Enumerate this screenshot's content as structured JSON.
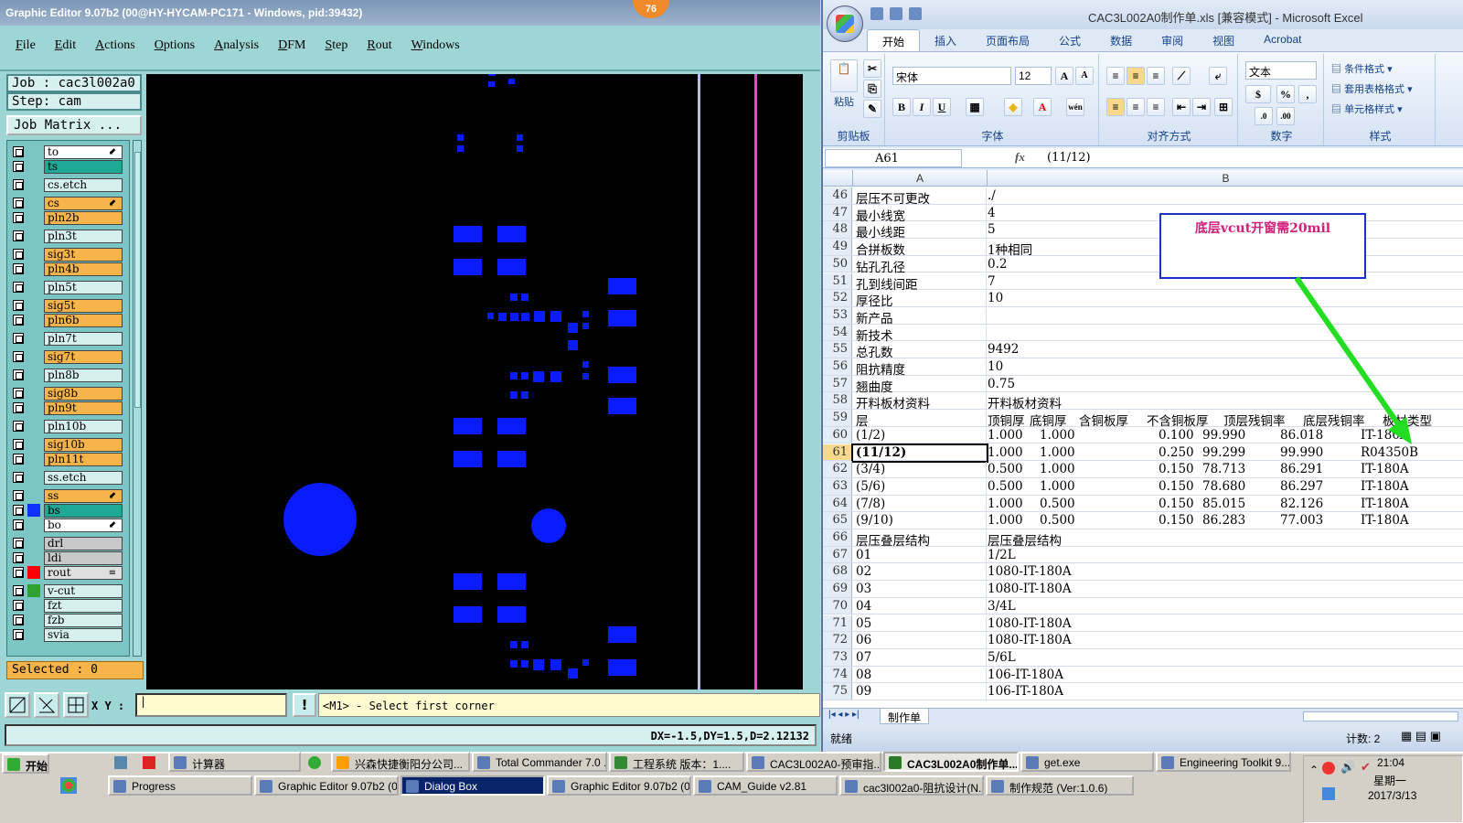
{
  "ge": {
    "title": "Graphic Editor 9.07b2 (00@HY-HYCAM-PC171 - Windows, pid:39432)",
    "badge": "76",
    "menu": [
      "File",
      "Edit",
      "Actions",
      "Options",
      "Analysis",
      "DFM",
      "Step",
      "Rout",
      "Windows"
    ],
    "job": "Job : cac3l002a0",
    "step": "Step: cam",
    "job_matrix": "Job Matrix ...",
    "layers": [
      {
        "name": "to",
        "color": "#ffffff",
        "mark": "⬋",
        "gap": false
      },
      {
        "name": "ts",
        "color": "#1ea896",
        "mark": "",
        "gap": false
      },
      {
        "name": "cs.etch",
        "color": "#d6f0f0",
        "mark": "",
        "gap": true
      },
      {
        "name": "cs",
        "color": "#f6b44a",
        "mark": "⬋",
        "gap": true
      },
      {
        "name": "pln2b",
        "color": "#f6b44a",
        "mark": "",
        "gap": false
      },
      {
        "name": "pln3t",
        "color": "#d6f0f0",
        "mark": "",
        "gap": true
      },
      {
        "name": "sig3t",
        "color": "#f6b44a",
        "mark": "",
        "gap": true
      },
      {
        "name": "pln4b",
        "color": "#f6b44a",
        "mark": "",
        "gap": false
      },
      {
        "name": "pln5t",
        "color": "#d6f0f0",
        "mark": "",
        "gap": true
      },
      {
        "name": "sig5t",
        "color": "#f6b44a",
        "mark": "",
        "gap": true
      },
      {
        "name": "pln6b",
        "color": "#f6b44a",
        "mark": "",
        "gap": false
      },
      {
        "name": "pln7t",
        "color": "#d6f0f0",
        "mark": "",
        "gap": true
      },
      {
        "name": "sig7t",
        "color": "#f6b44a",
        "mark": "",
        "gap": true
      },
      {
        "name": "pln8b",
        "color": "#d6f0f0",
        "mark": "",
        "gap": true
      },
      {
        "name": "sig8b",
        "color": "#f6b44a",
        "mark": "",
        "gap": true
      },
      {
        "name": "pln9t",
        "color": "#f6b44a",
        "mark": "",
        "gap": false
      },
      {
        "name": "pln10b",
        "color": "#d6f0f0",
        "mark": "",
        "gap": true
      },
      {
        "name": "sig10b",
        "color": "#f6b44a",
        "mark": "",
        "gap": true
      },
      {
        "name": "pln11t",
        "color": "#f6b44a",
        "mark": "",
        "gap": false
      },
      {
        "name": "ss.etch",
        "color": "#d6f0f0",
        "mark": "",
        "gap": true
      },
      {
        "name": "ss",
        "color": "#f6b44a",
        "mark": "⬋",
        "gap": true
      },
      {
        "name": "bs",
        "color": "#1ea896",
        "mark": "",
        "gap": false,
        "swatch": "#1030ff"
      },
      {
        "name": "bo",
        "color": "#ffffff",
        "mark": "⬋",
        "gap": false
      },
      {
        "name": "drl",
        "color": "#c8c8c8",
        "mark": "",
        "gap": true
      },
      {
        "name": "ldi",
        "color": "#c8c8c8",
        "mark": "",
        "gap": false
      },
      {
        "name": "rout",
        "color": "#e0e0e0",
        "mark": "≡",
        "gap": false,
        "swatch": "#ff0000"
      },
      {
        "name": "v-cut",
        "color": "#d6f0f0",
        "mark": "",
        "gap": true,
        "swatch": "#30a030"
      },
      {
        "name": "fzt",
        "color": "#d6f0f0",
        "mark": "",
        "gap": false
      },
      {
        "name": "fzb",
        "color": "#d6f0f0",
        "mark": "",
        "gap": false
      },
      {
        "name": "svia",
        "color": "#d6f0f0",
        "mark": "",
        "gap": false
      }
    ],
    "selected": "Selected : 0",
    "xy_label": "X Y :",
    "prompt": "<M1> - Select first corner",
    "status": "DX=-1.5,DY=1.5,D=2.12132",
    "colors": {
      "feature": "#0a1cff",
      "line1": "#b8b8ff",
      "line2": "#ff40c0"
    }
  },
  "xl": {
    "title": "CAC3L002A0制作单.xls  [兼容模式] - Microsoft Excel",
    "tabs": [
      "开始",
      "插入",
      "页面布局",
      "公式",
      "数据",
      "审阅",
      "视图",
      "Acrobat"
    ],
    "ribbon": {
      "paste": "粘贴",
      "clipboard": "剪贴板",
      "font_name": "宋体",
      "font_size": "12",
      "font": "字体",
      "align": "对齐方式",
      "num_format": "文本",
      "number": "数字",
      "cond_format": "条件格式",
      "table_format": "套用表格格式",
      "cell_style": "单元格样式",
      "styles": "样式"
    },
    "name_box": "A61",
    "formula": "(11/12)",
    "columns": [
      "A",
      "B"
    ],
    "rows": [
      {
        "n": "46",
        "a": "层压不可更改",
        "b": [
          "./"
        ]
      },
      {
        "n": "47",
        "a": "最小线宽",
        "b": [
          "4"
        ]
      },
      {
        "n": "48",
        "a": "最小线距",
        "b": [
          "5"
        ]
      },
      {
        "n": "49",
        "a": "合拼板数",
        "b": [
          "1种相同"
        ]
      },
      {
        "n": "50",
        "a": "钻孔孔径",
        "b": [
          "0.2"
        ]
      },
      {
        "n": "51",
        "a": "孔到线间距",
        "b": [
          "7"
        ]
      },
      {
        "n": "52",
        "a": "厚径比",
        "b": [
          "10"
        ]
      },
      {
        "n": "53",
        "a": "新产品",
        "b": []
      },
      {
        "n": "54",
        "a": "新技术",
        "b": []
      },
      {
        "n": "55",
        "a": "总孔数",
        "b": [
          "9492"
        ]
      },
      {
        "n": "56",
        "a": "阻抗精度",
        "b": [
          "10"
        ]
      },
      {
        "n": "57",
        "a": "翘曲度",
        "b": [
          "0.75"
        ]
      },
      {
        "n": "58",
        "a": "开料板材资料",
        "b": [
          "开料板材资料"
        ]
      },
      {
        "n": "59",
        "a": "层",
        "b": [
          "顶铜厚",
          "底铜厚",
          "含铜板厚",
          "不含铜板厚",
          "顶层残铜率",
          "底层残铜率",
          "板材类型"
        ]
      },
      {
        "n": "60",
        "a": "(1/2)",
        "b": [
          "1.000",
          "1.000",
          "",
          "0.100",
          "99.990",
          "86.018",
          "IT-180A"
        ]
      },
      {
        "n": "61",
        "a": "(11/12)",
        "b": [
          "1.000",
          "1.000",
          "",
          "0.250",
          "99.299",
          "99.990",
          "R04350B"
        ],
        "sel": true
      },
      {
        "n": "62",
        "a": "(3/4)",
        "b": [
          "0.500",
          "1.000",
          "",
          "0.150",
          "78.713",
          "86.291",
          "IT-180A"
        ]
      },
      {
        "n": "63",
        "a": "(5/6)",
        "b": [
          "0.500",
          "1.000",
          "",
          "0.150",
          "78.680",
          "86.297",
          "IT-180A"
        ]
      },
      {
        "n": "64",
        "a": "(7/8)",
        "b": [
          "1.000",
          "0.500",
          "",
          "0.150",
          "85.015",
          "82.126",
          "IT-180A"
        ]
      },
      {
        "n": "65",
        "a": "(9/10)",
        "b": [
          "1.000",
          "0.500",
          "",
          "0.150",
          "86.283",
          "77.003",
          "IT-180A"
        ]
      },
      {
        "n": "66",
        "a": "层压叠层结构",
        "b": [
          "层压叠层结构"
        ]
      },
      {
        "n": "67",
        "a": "01",
        "b": [
          "1/2L"
        ]
      },
      {
        "n": "68",
        "a": "02",
        "b": [
          "1080-IT-180A"
        ]
      },
      {
        "n": "69",
        "a": "03",
        "b": [
          "1080-IT-180A"
        ]
      },
      {
        "n": "70",
        "a": "04",
        "b": [
          "3/4L"
        ]
      },
      {
        "n": "71",
        "a": "05",
        "b": [
          "1080-IT-180A"
        ]
      },
      {
        "n": "72",
        "a": "06",
        "b": [
          "1080-IT-180A"
        ]
      },
      {
        "n": "73",
        "a": "07",
        "b": [
          "5/6L"
        ]
      },
      {
        "n": "74",
        "a": "08",
        "b": [
          "106-IT-180A"
        ]
      },
      {
        "n": "75",
        "a": "09",
        "b": [
          "106-IT-180A"
        ]
      }
    ],
    "callout": "底层vcut开窗需20mil",
    "sheet_tab": "制作单",
    "status_ready": "就绪",
    "status_count": "计数: 2"
  },
  "taskbar": {
    "start": "开始",
    "row1": [
      "计算器",
      "兴森快捷衡阳分公司...",
      "Total Commander 7.0 ...",
      "工程系统  版本：1....",
      "CAC3L002A0-预审指...",
      "CAC3L002A0制作单...",
      "get.exe",
      "Engineering Toolkit 9...."
    ],
    "row2": [
      "Progress",
      "Graphic Editor 9.07b2 (0...",
      "Dialog Box",
      "Graphic Editor 9.07b2 (0...",
      "CAM_Guide v2.81",
      "cac3l002a0-阻抗设计(N...",
      "制作规范 (Ver:1.0.6)"
    ],
    "time": "21:04",
    "weekday": "星期一",
    "date": "2017/3/13"
  }
}
